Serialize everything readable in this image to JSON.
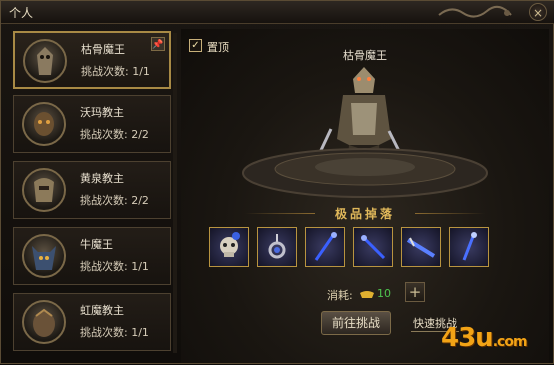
{
  "window": {
    "title": "个人",
    "close_glyph": "×"
  },
  "bosses": [
    {
      "name": "枯骨魔王",
      "count": "挑战次数: 1/1",
      "selected": true,
      "pin": "📌"
    },
    {
      "name": "沃玛教主",
      "count": "挑战次数: 2/2"
    },
    {
      "name": "黄泉教主",
      "count": "挑战次数: 2/2"
    },
    {
      "name": "牛魔王",
      "count": "挑战次数: 1/1"
    },
    {
      "name": "虹魔教主",
      "count": "挑战次数: 1/1"
    }
  ],
  "main": {
    "pin_top_checked": true,
    "pin_top_label": "置顶",
    "model_name": "枯骨魔王",
    "drop_title": "极品掉落",
    "items": [
      {
        "icon": "skull-item-icon"
      },
      {
        "icon": "amulet-item-icon"
      },
      {
        "icon": "blue-staff-icon"
      },
      {
        "icon": "blue-staff-icon"
      },
      {
        "icon": "blue-sword-icon"
      },
      {
        "icon": "blue-wand-icon"
      }
    ],
    "cost_label": "消耗:",
    "cost_value": "10",
    "add_label": "+",
    "go_button": "前往挑战",
    "fast_button": "快速挑战"
  },
  "watermark": {
    "main": "43u",
    "suffix": ".com"
  },
  "colors": {
    "gold_border": "#a88a45",
    "cost_green": "#4ec24e",
    "watermark": "#f2a316"
  }
}
